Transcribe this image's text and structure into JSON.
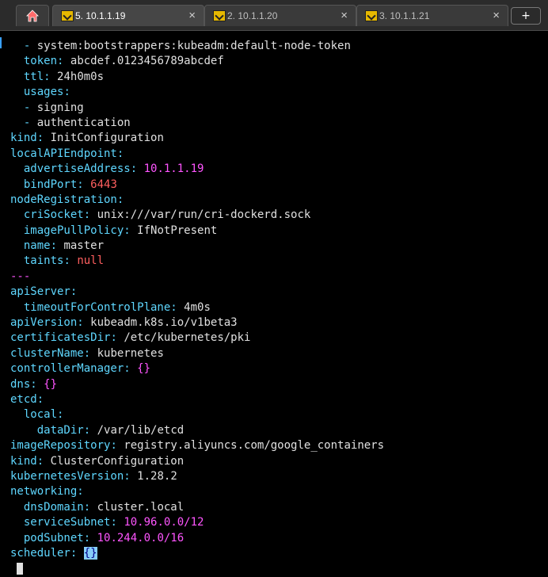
{
  "tabs": [
    {
      "label": "5. 10.1.1.19",
      "close": "×",
      "active": true
    },
    {
      "label": "2. 10.1.1.20",
      "close": "×",
      "active": false
    },
    {
      "label": "3. 10.1.1.21",
      "close": "×",
      "active": false
    }
  ],
  "new_tab_label": "+",
  "editor": {
    "lines": [
      {
        "indent": "  ",
        "prefix": "- ",
        "key": "",
        "value": "system:bootstrappers:kubeadm:default-node-token",
        "vcolor": "v"
      },
      {
        "indent": "  ",
        "prefix": "",
        "key": "token",
        "value": "abcdef.0123456789abcdef",
        "vcolor": "v"
      },
      {
        "indent": "  ",
        "prefix": "",
        "key": "ttl",
        "value": "24h0m0s",
        "vcolor": "v"
      },
      {
        "indent": "  ",
        "prefix": "",
        "key": "usages",
        "value": "",
        "vcolor": "v"
      },
      {
        "indent": "  ",
        "prefix": "- ",
        "key": "",
        "value": "signing",
        "vcolor": "v"
      },
      {
        "indent": "  ",
        "prefix": "- ",
        "key": "",
        "value": "authentication",
        "vcolor": "v"
      },
      {
        "indent": "",
        "prefix": "",
        "key": "kind",
        "value": "InitConfiguration",
        "vcolor": "v"
      },
      {
        "indent": "",
        "prefix": "",
        "key": "localAPIEndpoint",
        "value": "",
        "vcolor": "v"
      },
      {
        "indent": "  ",
        "prefix": "",
        "key": "advertiseAddress",
        "value": "10.1.1.19",
        "vcolor": "m"
      },
      {
        "indent": "  ",
        "prefix": "",
        "key": "bindPort",
        "value": "6443",
        "vcolor": "r"
      },
      {
        "indent": "",
        "prefix": "",
        "key": "nodeRegistration",
        "value": "",
        "vcolor": "v"
      },
      {
        "indent": "  ",
        "prefix": "",
        "key": "criSocket",
        "value": "unix:///var/run/cri-dockerd.sock",
        "vcolor": "v"
      },
      {
        "indent": "  ",
        "prefix": "",
        "key": "imagePullPolicy",
        "value": "IfNotPresent",
        "vcolor": "v"
      },
      {
        "indent": "  ",
        "prefix": "",
        "key": "name",
        "value": "master",
        "vcolor": "v"
      },
      {
        "indent": "  ",
        "prefix": "",
        "key": "taints",
        "value": "null",
        "vcolor": "r"
      },
      {
        "indent": "",
        "prefix": "---",
        "key": "",
        "value": "",
        "vcolor": "m"
      },
      {
        "indent": "",
        "prefix": "",
        "key": "apiServer",
        "value": "",
        "vcolor": "v"
      },
      {
        "indent": "  ",
        "prefix": "",
        "key": "timeoutForControlPlane",
        "value": "4m0s",
        "vcolor": "v"
      },
      {
        "indent": "",
        "prefix": "",
        "key": "apiVersion",
        "value": "kubeadm.k8s.io/v1beta3",
        "vcolor": "v"
      },
      {
        "indent": "",
        "prefix": "",
        "key": "certificatesDir",
        "value": "/etc/kubernetes/pki",
        "vcolor": "v"
      },
      {
        "indent": "",
        "prefix": "",
        "key": "clusterName",
        "value": "kubernetes",
        "vcolor": "v"
      },
      {
        "indent": "",
        "prefix": "",
        "key": "controllerManager",
        "value": "{}",
        "vcolor": "m"
      },
      {
        "indent": "",
        "prefix": "",
        "key": "dns",
        "value": "{}",
        "vcolor": "m"
      },
      {
        "indent": "",
        "prefix": "",
        "key": "etcd",
        "value": "",
        "vcolor": "v"
      },
      {
        "indent": "  ",
        "prefix": "",
        "key": "local",
        "value": "",
        "vcolor": "v"
      },
      {
        "indent": "    ",
        "prefix": "",
        "key": "dataDir",
        "value": "/var/lib/etcd",
        "vcolor": "v"
      },
      {
        "indent": "",
        "prefix": "",
        "key": "imageRepository",
        "value": "registry.aliyuncs.com/google_containers",
        "vcolor": "v"
      },
      {
        "indent": "",
        "prefix": "",
        "key": "kind",
        "value": "ClusterConfiguration",
        "vcolor": "v"
      },
      {
        "indent": "",
        "prefix": "",
        "key": "kubernetesVersion",
        "value": "1.28.2",
        "vcolor": "v"
      },
      {
        "indent": "",
        "prefix": "",
        "key": "networking",
        "value": "",
        "vcolor": "v"
      },
      {
        "indent": "  ",
        "prefix": "",
        "key": "dnsDomain",
        "value": "cluster.local",
        "vcolor": "v"
      },
      {
        "indent": "  ",
        "prefix": "",
        "key": "serviceSubnet",
        "value": "10.96.0.0/12",
        "vcolor": "m"
      },
      {
        "indent": "  ",
        "prefix": "",
        "key": "podSubnet",
        "value": "10.244.0.0/16",
        "vcolor": "m"
      },
      {
        "indent": "",
        "prefix": "",
        "key": "scheduler",
        "value": "{}",
        "vcolor": "sel"
      }
    ]
  },
  "colors": {
    "key": "#5fd7ff",
    "value": "#e0e0e0",
    "magenta": "#ff55ff",
    "red": "#ff5f5f",
    "selection": "#87cefa",
    "tab_icon": "#e6b800"
  },
  "icons": {
    "home": "home-icon",
    "session": "terminal-session-icon",
    "close": "close-icon",
    "new_tab": "plus-icon"
  }
}
